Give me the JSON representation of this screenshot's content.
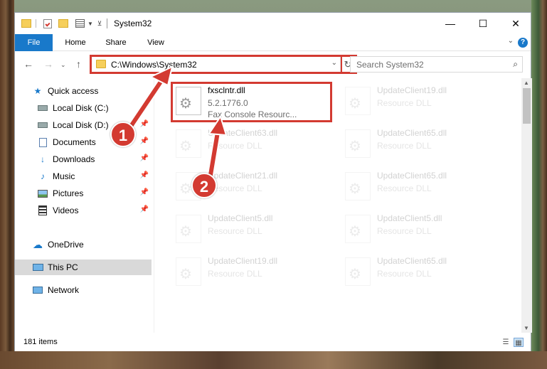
{
  "window": {
    "title": "System32",
    "minimize": "—",
    "maximize": "☐",
    "close": "✕"
  },
  "ribbon": {
    "tabs": [
      "File",
      "Home",
      "Share",
      "View"
    ],
    "help": "?"
  },
  "nav": {
    "address": "C:\\Windows\\System32",
    "search_placeholder": "Search System32"
  },
  "sidebar": {
    "items": [
      {
        "label": "Quick access",
        "icon": "star-icon"
      },
      {
        "label": "Local Disk (C:)",
        "icon": "drive-icon"
      },
      {
        "label": "Local Disk (D:)",
        "icon": "drive-icon"
      },
      {
        "label": "Documents",
        "icon": "documents-icon"
      },
      {
        "label": "Downloads",
        "icon": "download-icon"
      },
      {
        "label": "Music",
        "icon": "music-icon"
      },
      {
        "label": "Pictures",
        "icon": "pictures-icon"
      },
      {
        "label": "Videos",
        "icon": "videos-icon"
      },
      {
        "label": "OneDrive",
        "icon": "cloud-icon"
      },
      {
        "label": "This PC",
        "icon": "monitor-icon"
      },
      {
        "label": "Network",
        "icon": "network-icon"
      }
    ]
  },
  "files": [
    {
      "name": "fxsclntr.dll",
      "line2": "5.2.1776.0",
      "line3": "Fax Console Resourc..."
    },
    {
      "name": "UpdateClient19.dll",
      "line2": "Resource DLL",
      "line3": ""
    },
    {
      "name": "UpdateClient63.dll",
      "line2": "Resource DLL",
      "line3": ""
    },
    {
      "name": "UpdateClient65.dll",
      "line2": "Resource DLL",
      "line3": ""
    },
    {
      "name": "UpdateClient21.dll",
      "line2": "Resource DLL",
      "line3": ""
    },
    {
      "name": "UpdateClient65.dll",
      "line2": "Resource DLL",
      "line3": ""
    },
    {
      "name": "UpdateClient5.dll",
      "line2": "Resource DLL",
      "line3": ""
    },
    {
      "name": "UpdateClient5.dll",
      "line2": "Resource DLL",
      "line3": ""
    },
    {
      "name": "UpdateClient19.dll",
      "line2": "Resource DLL",
      "line3": ""
    },
    {
      "name": "UpdateClient65.dll",
      "line2": "Resource DLL",
      "line3": ""
    }
  ],
  "status": {
    "item_count": "181 items"
  },
  "callouts": {
    "one": "1",
    "two": "2"
  },
  "colors": {
    "accent": "#1979ca",
    "highlight": "#d33a31",
    "folder": "#f6cf5b"
  }
}
